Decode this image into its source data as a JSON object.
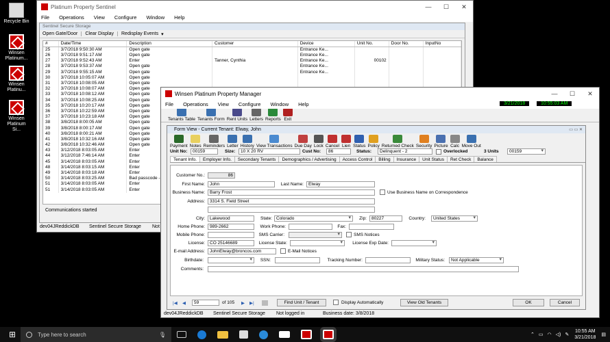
{
  "desktop": {
    "icons": [
      {
        "label": "Recycle Bin"
      },
      {
        "label": "Winsen\nPlatinum..."
      },
      {
        "label": "Winsen\nPlatinu..."
      },
      {
        "label": "Winsen\nPlatinum Si..."
      }
    ]
  },
  "sentinel": {
    "title": "Platinum Property Sentinel",
    "menu": [
      "File",
      "Operations",
      "View",
      "Configure",
      "Window",
      "Help"
    ],
    "inner_title": "Sentinel Secure Storage",
    "toolbar": [
      "Open Gate/Door",
      "Clear Display",
      "Redisplay Events"
    ],
    "columns": [
      "#",
      "Date/Time",
      "Description",
      "Customer",
      "Device",
      "Unit No.",
      "Door No.",
      "InputNo"
    ],
    "rows": [
      [
        "25",
        "3/7/2018 9:50:30 AM",
        "Open gate",
        "",
        "Entrance Ke...",
        "",
        "",
        ""
      ],
      [
        "26",
        "3/7/2018 9:51:17 AM",
        "Open gate",
        "",
        "Entrance Ke...",
        "",
        "",
        ""
      ],
      [
        "27",
        "3/7/2018 9:52:43 AM",
        "Enter",
        "Tanner, Cynthia",
        "Entrance Ke...",
        "00102",
        "",
        ""
      ],
      [
        "28",
        "3/7/2018 9:53:37 AM",
        "Open gate",
        "",
        "Entrance Ke...",
        "",
        "",
        ""
      ],
      [
        "29",
        "3/7/2018 9:55:15 AM",
        "Open gate",
        "",
        "Entrance Ke...",
        "",
        "",
        ""
      ],
      [
        "30",
        "3/7/2018 10:05:07 AM",
        "Open gate",
        "",
        "",
        "",
        "",
        ""
      ],
      [
        "31",
        "3/7/2018 10:08:05 AM",
        "Open gate",
        "",
        "",
        "",
        "",
        ""
      ],
      [
        "32",
        "3/7/2018 10:08:07 AM",
        "Open gate",
        "",
        "",
        "",
        "",
        ""
      ],
      [
        "33",
        "3/7/2018 10:08:12 AM",
        "Open gate",
        "",
        "",
        "",
        "",
        ""
      ],
      [
        "34",
        "3/7/2018 10:08:25 AM",
        "Open gate",
        "",
        "",
        "",
        "",
        ""
      ],
      [
        "35",
        "3/7/2018 10:20:17 AM",
        "Open gate",
        "",
        "",
        "",
        "",
        ""
      ],
      [
        "36",
        "3/7/2018 10:22:59 AM",
        "Open gate",
        "",
        "",
        "",
        "",
        ""
      ],
      [
        "37",
        "3/7/2018 10:23:18 AM",
        "Open gate",
        "",
        "",
        "",
        "",
        ""
      ],
      [
        "38",
        "3/8/2018 8:00:05 AM",
        "Open gate",
        "",
        "",
        "",
        "",
        ""
      ],
      [
        "39",
        "3/8/2018 8:00:17 AM",
        "Open gate",
        "",
        "",
        "",
        "",
        ""
      ],
      [
        "40",
        "3/8/2018 8:00:21 AM",
        "Open gate",
        "",
        "",
        "",
        "",
        ""
      ],
      [
        "41",
        "3/8/2018 10:32:16 AM",
        "Open gate",
        "",
        "",
        "",
        "",
        ""
      ],
      [
        "42",
        "3/8/2018 10:32:46 AM",
        "Open gate",
        "",
        "",
        "",
        "",
        ""
      ],
      [
        "43",
        "3/12/2018 8:03:05 AM",
        "Enter",
        "",
        "",
        "",
        "",
        ""
      ],
      [
        "44",
        "3/12/2018 7:46:14 AM",
        "Enter",
        "",
        "",
        "",
        "",
        ""
      ],
      [
        "45",
        "3/14/2018 8:03:05 AM",
        "Enter",
        "",
        "",
        "",
        "",
        ""
      ],
      [
        "48",
        "3/14/2018 8:03:15 AM",
        "Enter",
        "",
        "",
        "",
        "",
        ""
      ],
      [
        "49",
        "3/14/2018 8:03:18 AM",
        "Enter",
        "",
        "",
        "",
        "",
        ""
      ],
      [
        "50",
        "3/14/2018 8:03:25 AM",
        "Bad passcode - T...",
        "",
        "",
        "",
        "",
        ""
      ],
      [
        "51",
        "3/14/2018 8:03:05 AM",
        "Enter",
        "",
        "",
        "",
        "",
        ""
      ],
      [
        "51",
        "3/14/2018 8:03:05 AM",
        "Enter",
        "",
        "",
        "",
        "",
        ""
      ]
    ],
    "status": "Communications started",
    "bottom": [
      "dev04JReddickDB",
      "Sentinel Secure Storage",
      "Not logged in"
    ]
  },
  "manager": {
    "title": "Winsen Platinum Property Manager",
    "menu": [
      "File",
      "Operations",
      "View",
      "Configure",
      "Window",
      "Help"
    ],
    "date": "3/21/2018",
    "time": "10:55:03 AM",
    "toolbar": [
      "Tenants Table",
      "Tenants Form",
      "Rent Units",
      "Letters",
      "Reports",
      "Exit"
    ],
    "form": {
      "title": "Form View - Current Tenant: Elway, John",
      "toolbar": [
        "Payment",
        "Notes",
        "Reminders",
        "Letter",
        "History",
        "View Transactions",
        "Due Day",
        "Lock",
        "Cancel",
        "Lien",
        "Status",
        "Policy",
        "Returned Check",
        "Security",
        "Picture",
        "Calc",
        "Move Out"
      ],
      "unit_label": "Unit No:",
      "unit": "00159",
      "size_label": "Size:",
      "size": "10 X 20 RV",
      "cust_label": "Cust No:",
      "cust": "86",
      "status_label": "Status:",
      "status": "Delinquent - 2",
      "overlocked": "Overlocked",
      "units_count": "3 Units",
      "units_value": "00159",
      "tabs": [
        "Tenant Info.",
        "Employer Info.",
        "Secondary Tenants",
        "Demographics / Advertising",
        "Access Control",
        "Billing",
        "Insurance",
        "Unit Status",
        "Ret Check",
        "Balance"
      ],
      "labels": {
        "customer_no": "Customer No.:",
        "first": "First Name:",
        "last": "Last Name:",
        "business": "Business Name:",
        "use_business": "Use Business Name on Correspondence",
        "address": "Address:",
        "city": "City:",
        "state": "State:",
        "zip": "Zip:",
        "country": "Country:",
        "home_phone": "Home Phone:",
        "work_phone": "Work Phone:",
        "fax": "Fax:",
        "mobile_phone": "Mobile Phone:",
        "sms_carrier": "SMS Carrier:",
        "sms_notices": "SMS Notices",
        "license": "License:",
        "license_state": "License State:",
        "license_exp": "License Exp Date:",
        "email": "E-mail Address:",
        "email_notices": "E-Mail Notices",
        "birthdate": "Birthdate:",
        "ssn": "SSN:",
        "tracking": "Tracking Number:",
        "military": "Military Status:",
        "comments": "Comments:"
      },
      "values": {
        "customer_no": "86",
        "first": "John",
        "last": "Elway",
        "business": "Barry Frost",
        "address": "3314 S. Field Street",
        "city": "Lakewood",
        "state": "Colorado",
        "zip": "80227",
        "country": "United States",
        "home_phone": "989-2662",
        "license": "CO 25146689",
        "email": "JohnElway@broncos.com",
        "military": "Not Applicable"
      },
      "nav": {
        "current": "59",
        "of": "of 105"
      },
      "buttons": {
        "find": "Find Unit / Tenant",
        "display_auto": "Display Automatically",
        "view_old": "View Old Tenants",
        "ok": "OK",
        "cancel": "Cancel"
      }
    },
    "status": [
      "dev04JReddickDB",
      "Sentinel Secure Storage",
      "Not logged in",
      "Business date: 3/8/2018"
    ]
  },
  "taskbar": {
    "search_placeholder": "Type here to search",
    "time": "10:55 AM",
    "date": "3/21/2018"
  }
}
